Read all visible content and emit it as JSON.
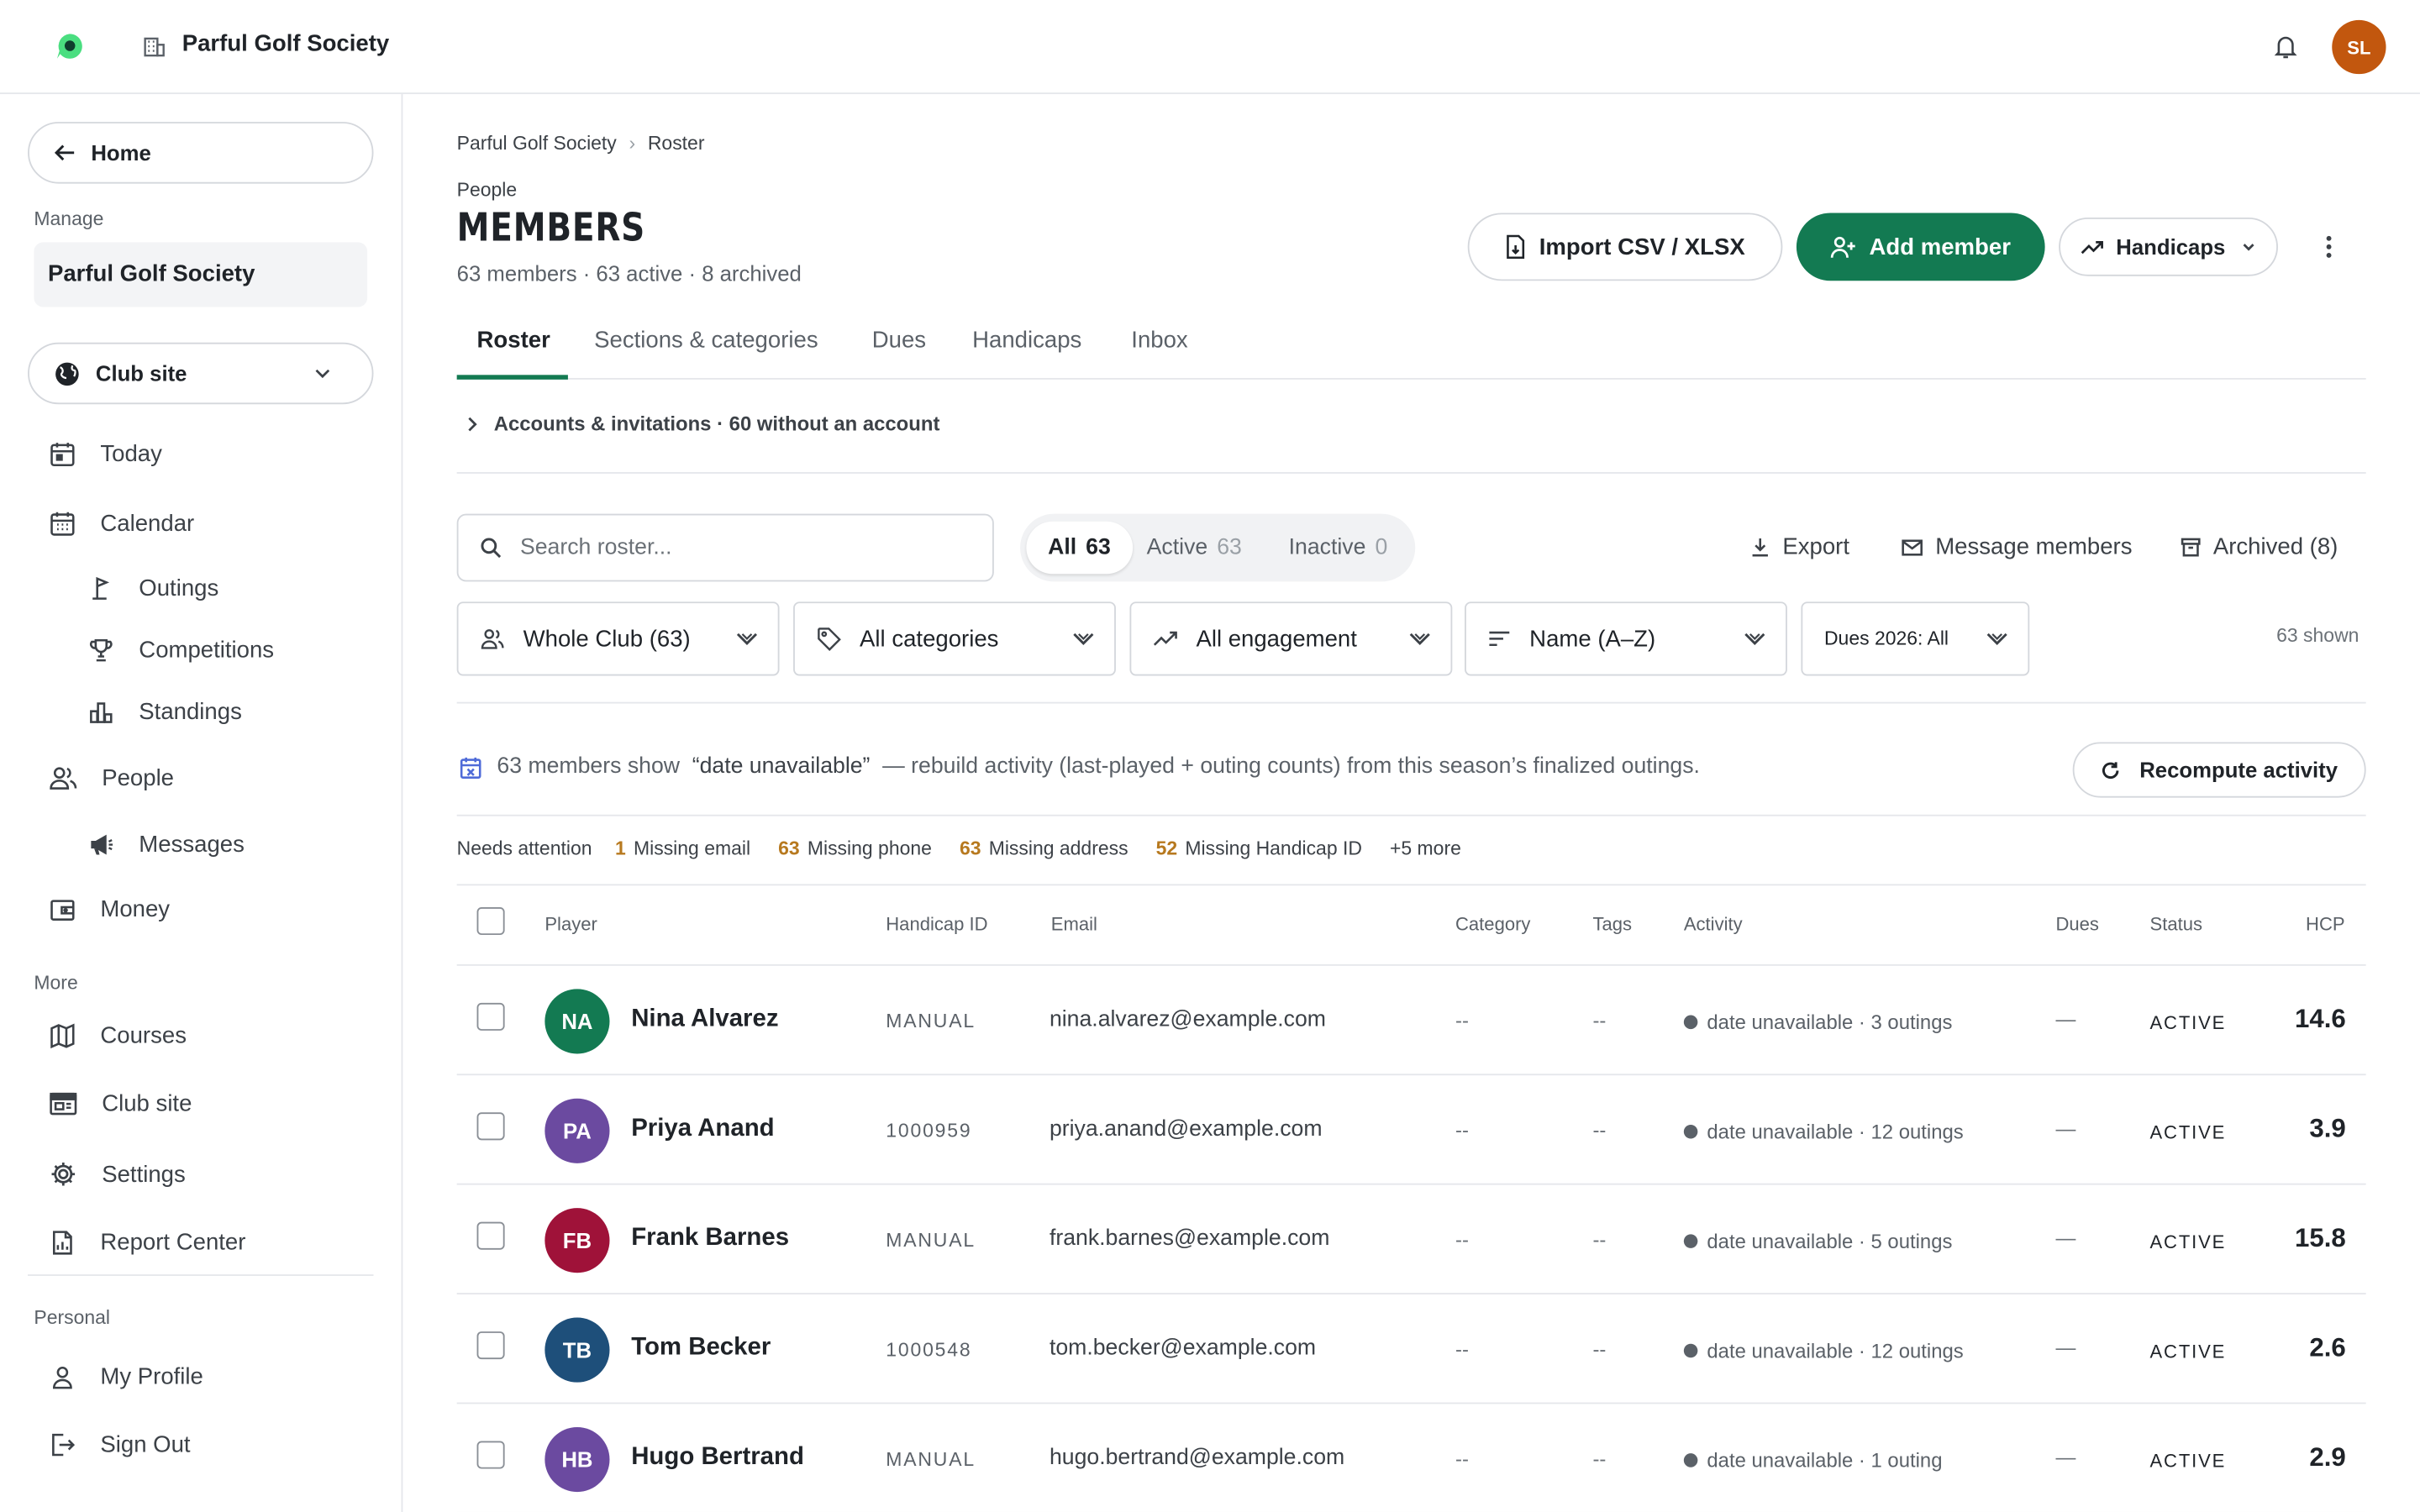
{
  "topbar": {
    "org_name": "Parful Golf Society",
    "user_initials": "SL",
    "avatar_color": "#c2570e"
  },
  "sidebar": {
    "home_label": "Home",
    "manage_label": "Manage",
    "org_name": "Parful Golf Society",
    "site_select": "Club site",
    "items": {
      "today": "Today",
      "calendar": "Calendar",
      "outings": "Outings",
      "competitions": "Competitions",
      "standings": "Standings",
      "people": "People",
      "messages": "Messages",
      "money": "Money"
    },
    "more_label": "More",
    "more_items": {
      "courses": "Courses",
      "club_site": "Club site",
      "settings": "Settings",
      "report_center": "Report Center"
    },
    "personal_label": "Personal",
    "personal_items": {
      "my_profile": "My Profile",
      "sign_out": "Sign Out"
    }
  },
  "main": {
    "breadcrumb": [
      "Parful Golf Society",
      "Roster"
    ],
    "eyebrow": "People",
    "title": "MEMBERS",
    "subtitle": "63 members · 63 active · 8 archived",
    "buttons": {
      "import": "Import CSV / XLSX",
      "add_member": "Add member",
      "handicaps": "Handicaps"
    },
    "tabs": [
      "Roster",
      "Sections & categories",
      "Dues",
      "Handicaps",
      "Inbox"
    ],
    "accounts_text": "Accounts & invitations · 60 without an account",
    "search_placeholder": "Search roster...",
    "segments": [
      {
        "label": "All",
        "count": "63"
      },
      {
        "label": "Active",
        "count": "63"
      },
      {
        "label": "Inactive",
        "count": "0"
      }
    ],
    "actions": {
      "export": "Export",
      "message": "Message members",
      "archived": "Archived (8)"
    },
    "filters": {
      "group": "Whole Club (63)",
      "categories": "All categories",
      "engagement": "All engagement",
      "sort": "Name (A–Z)",
      "dues": "Dues 2026: All"
    },
    "shown_text": "63 shown",
    "notice": {
      "lead": "63 members show",
      "quote": "“date unavailable”",
      "rest": "— rebuild activity (last-played + outing counts) from this season’s finalized outings.",
      "button": "Recompute activity"
    },
    "attention": {
      "label": "Needs attention",
      "chips": [
        {
          "num": "1",
          "text": "Missing email"
        },
        {
          "num": "63",
          "text": "Missing phone"
        },
        {
          "num": "63",
          "text": "Missing address"
        },
        {
          "num": "52",
          "text": "Missing Handicap ID"
        }
      ],
      "more": "+5 more"
    },
    "table": {
      "headers": {
        "player": "Player",
        "handicap_id": "Handicap ID",
        "email": "Email",
        "category": "Category",
        "tags": "Tags",
        "activity": "Activity",
        "dues": "Dues",
        "status": "Status",
        "hcp": "HCP"
      },
      "rows": [
        {
          "initials": "NA",
          "color": "#137a52",
          "name": "Nina Alvarez",
          "hid": "MANUAL",
          "email": "nina.alvarez@example.com",
          "category": "--",
          "tags": "--",
          "activity": "date unavailable · 3 outings",
          "dues": "—",
          "status": "ACTIVE",
          "hcp": "14.6"
        },
        {
          "initials": "PA",
          "color": "#6b4aa0",
          "name": "Priya Anand",
          "hid": "1000959",
          "email": "priya.anand@example.com",
          "category": "--",
          "tags": "--",
          "activity": "date unavailable · 12 outings",
          "dues": "—",
          "status": "ACTIVE",
          "hcp": "3.9"
        },
        {
          "initials": "FB",
          "color": "#9f1239",
          "name": "Frank Barnes",
          "hid": "MANUAL",
          "email": "frank.barnes@example.com",
          "category": "--",
          "tags": "--",
          "activity": "date unavailable · 5 outings",
          "dues": "—",
          "status": "ACTIVE",
          "hcp": "15.8"
        },
        {
          "initials": "TB",
          "color": "#1e4f7a",
          "name": "Tom Becker",
          "hid": "1000548",
          "email": "tom.becker@example.com",
          "category": "--",
          "tags": "--",
          "activity": "date unavailable · 12 outings",
          "dues": "—",
          "status": "ACTIVE",
          "hcp": "2.6"
        },
        {
          "initials": "HB",
          "color": "#6b4aa0",
          "name": "Hugo Bertrand",
          "hid": "MANUAL",
          "email": "hugo.bertrand@example.com",
          "category": "--",
          "tags": "--",
          "activity": "date unavailable · 1 outing",
          "dues": "—",
          "status": "ACTIVE",
          "hcp": "2.9"
        }
      ]
    }
  },
  "colors": {
    "brand": "#137a52",
    "warning": "#b7791f"
  }
}
